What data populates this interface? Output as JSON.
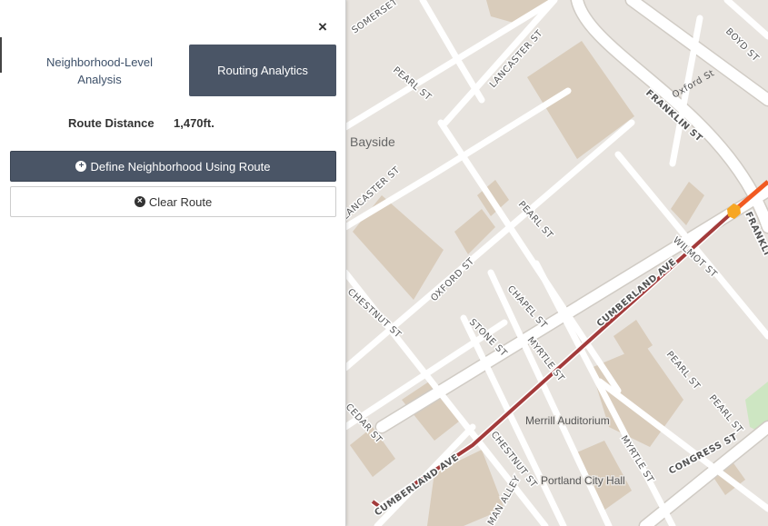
{
  "panel": {
    "close_label": "×",
    "tabs": [
      {
        "label": "Neighborhood-Level Analysis"
      },
      {
        "label": "Routing Analytics"
      }
    ],
    "route_distance_label": "Route Distance",
    "route_distance_value": "1,470ft.",
    "define_button_label": "Define Neighborhood Using Route",
    "clear_button_label": "Clear Route"
  },
  "map": {
    "place_label": "Bayside",
    "poi_labels": [
      "Merrill Auditorium",
      "Portland City Hall"
    ],
    "street_labels": [
      "SOMERSET",
      "LANCASTER ST",
      "PEARL ST",
      "BOYD ST",
      "Oxford St",
      "FRANKLIN ST",
      "LANCASTER ST",
      "PEARL ST",
      "FRANKLI",
      "WILMOT ST",
      "OXFORD ST",
      "CHESTNUT ST",
      "CHAPEL ST",
      "CUMBERLAND AVE",
      "STONE ST",
      "MYRTLE ST",
      "PEARL ST",
      "PEARL ST",
      "CEDAR ST",
      "CHESTNUT ST",
      "MYRTLE ST",
      "CONGRESS ST",
      "CUMBERLAND AVE",
      "MAN ALLEY"
    ],
    "colors": {
      "background": "#e8e4df",
      "road": "#ffffff",
      "building": "#d9ccbb",
      "route": "#a33b3b",
      "highlight": "#f15a22",
      "marker": "#f7a623",
      "park": "#cde6c2"
    }
  }
}
